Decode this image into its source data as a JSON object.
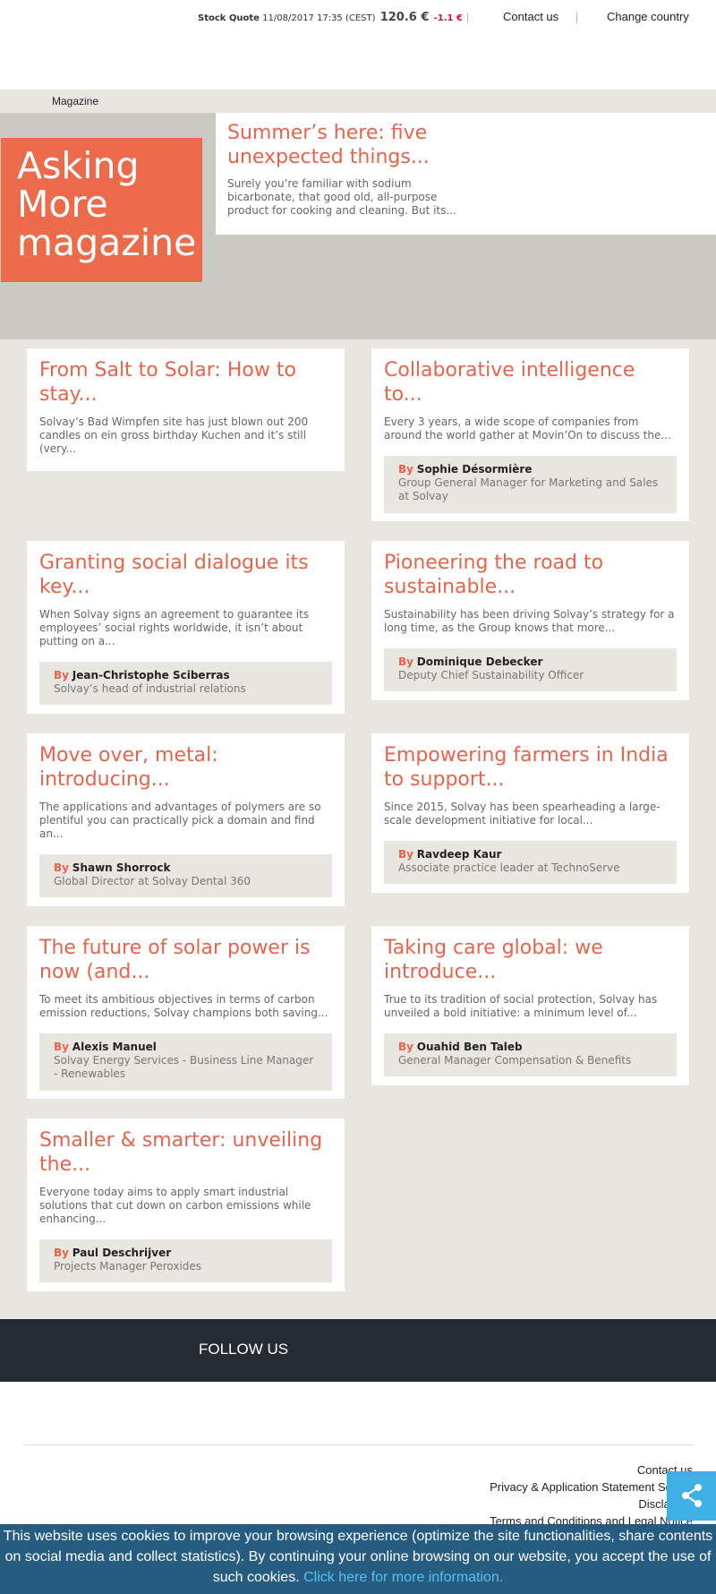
{
  "header": {
    "stock_label": "Stock Quote",
    "stock_datetime": "11/08/2017 17:35 (CEST)",
    "stock_price": "120.6 €",
    "stock_change": "-1.1 €",
    "contact": "Contact us",
    "change_country": "Change country"
  },
  "breadcrumb": {
    "section": "Magazine"
  },
  "hero": {
    "brand_line1": "Asking",
    "brand_line2": "More",
    "brand_line3": "magazine",
    "title": "Summer’s here: five unexpected things...",
    "excerpt": "Surely you’re familiar with sodium bicarbonate, that good old, all-purpose product for cooking and cleaning. But its..."
  },
  "by_label": "By",
  "articles": [
    {
      "title": "From Salt to Solar: How to stay...",
      "excerpt": "Solvay’s Bad Wimpfen site has just blown out 200 candles on ein gross birthday Kuchen and it’s still (very..."
    },
    {
      "title": "Collaborative intelligence to...",
      "excerpt": "Every 3 years, a wide scope of companies from around the world gather at Movin’On to discuss the...",
      "author": "Sophie Désormière",
      "role": "Group General Manager for Marketing and Sales at Solvay"
    },
    {
      "title": "Granting social dialogue its key...",
      "excerpt": "When Solvay signs an agreement to guarantee its employees’ social rights worldwide, it isn’t about putting on a...",
      "author": "Jean-Christophe Sciberras",
      "role": "Solvay’s head of industrial relations"
    },
    {
      "title": "Pioneering the road to sustainable...",
      "excerpt": "Sustainability has been driving Solvay’s strategy for a long time, as the Group knows that more...",
      "author": "Dominique Debecker",
      "role": "Deputy Chief Sustainability Officer"
    },
    {
      "title": "Move over, metal: introducing...",
      "excerpt": "The applications and advantages of polymers are so plentiful you can practically pick a domain and find an...",
      "author": "Shawn Shorrock",
      "role": "Global Director at Solvay Dental 360"
    },
    {
      "title": "Empowering farmers in India to support...",
      "excerpt": "Since 2015, Solvay has been spearheading a large-scale development initiative for local...",
      "author": "Ravdeep Kaur",
      "role": "Associate practice leader at TechnoServe"
    },
    {
      "title": "The future of solar power is now (and...",
      "excerpt": "To meet its ambitious objectives in terms of carbon emission reductions, Solvay champions both saving...",
      "author": "Alexis Manuel",
      "role": "Solvay Energy Services - Business Line Manager - Renewables"
    },
    {
      "title": "Taking care global: we introduce...",
      "excerpt": "True to its tradition of social protection, Solvay has unveiled a bold initiative: a minimum level of...",
      "author": "Ouahid Ben Taleb",
      "role": "General Manager Compensation & Benefits"
    },
    {
      "title": "Smaller & smarter: unveiling the...",
      "excerpt": "Everyone today aims to apply smart industrial solutions that cut down on carbon emissions while enhancing...",
      "author": "Paul Deschrijver",
      "role": "Projects Manager Peroxides"
    }
  ],
  "follow": {
    "label": "FOLLOW US"
  },
  "footer": {
    "links": [
      "Contact us",
      "Privacy & Application Statement Solvay",
      "Disclaimer",
      "Terms and Conditions and Legal Notice"
    ]
  },
  "share": {
    "icon": "share-icon",
    "color": "#3eb0e3"
  },
  "cookie": {
    "text": "This website uses cookies to improve your browsing experience (optimize the site functionalities, share contents on social media and collect statistics). By continuing your online browsing on our website, you accept the use of such cookies.",
    "link": "Click here for more information."
  },
  "colors": {
    "accent": "#e8634a",
    "hero_orange": "#ec6b4b",
    "footer_dark": "#252a33",
    "page_bg": "#e8e6e1"
  }
}
